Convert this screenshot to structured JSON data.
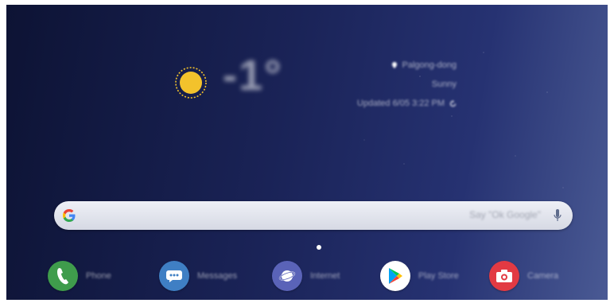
{
  "weather": {
    "temperature": "-1°",
    "location": "Palgong-dong",
    "condition": "Sunny",
    "updated": "Updated 6/05 3:22 PM"
  },
  "search": {
    "placeholder": "Say \"Ok Google\""
  },
  "dock": {
    "apps": [
      {
        "label": "Phone",
        "icon": "phone-icon",
        "color": "#3f9c4c"
      },
      {
        "label": "Messages",
        "icon": "messages-icon",
        "color": "#3f7fc4"
      },
      {
        "label": "Internet",
        "icon": "internet-icon",
        "color": "#5a63b8"
      },
      {
        "label": "Play Store",
        "icon": "play-store-icon",
        "color": "#ffffff"
      },
      {
        "label": "Camera",
        "icon": "camera-icon",
        "color": "#e23a43"
      }
    ]
  },
  "colors": {
    "sun": "#f3c22c",
    "wallpaper_dark": "#0d1334",
    "wallpaper_light": "#4a5a94"
  }
}
